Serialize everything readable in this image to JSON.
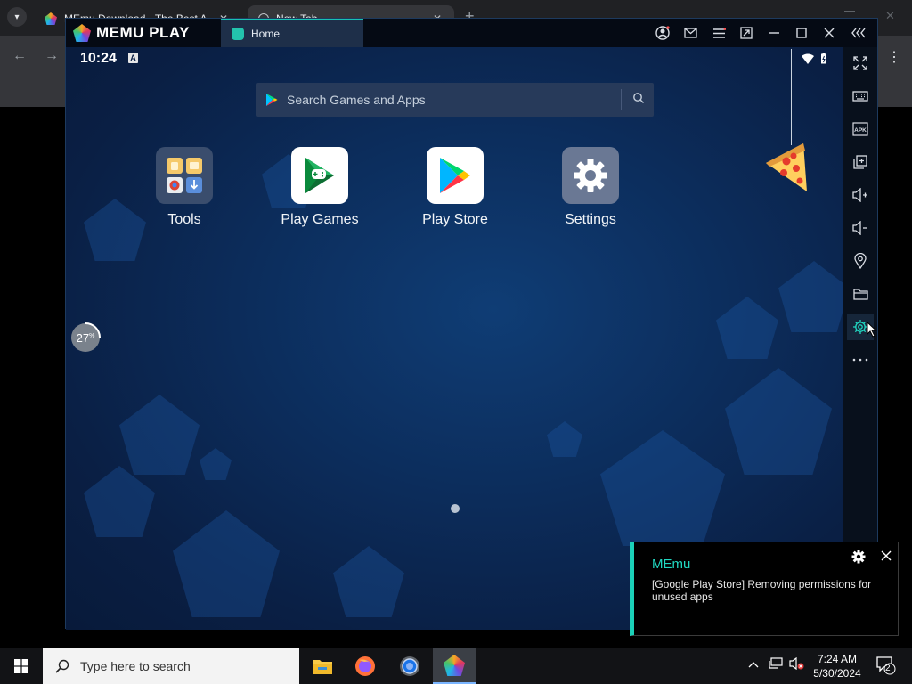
{
  "browser": {
    "tab1_title": "MEmu Download - The Best A",
    "tab2_title": "New Tab",
    "close_glyph": "✕",
    "new_tab_glyph": "+"
  },
  "memu": {
    "brand": "MEMU PLAY",
    "tab_label": "Home",
    "status_time": "10:24",
    "status_a": "A",
    "search_placeholder": "Search Games and Apps",
    "cpu_percent": "27",
    "cpu_unit": "%",
    "cpu_value": 27,
    "apps": [
      {
        "label": "Tools",
        "icon": "tools-folder-icon"
      },
      {
        "label": "Play Games",
        "icon": "play-games-icon"
      },
      {
        "label": "Play Store",
        "icon": "play-store-icon"
      },
      {
        "label": "Settings",
        "icon": "settings-icon"
      }
    ],
    "page_indicator": {
      "current": 1,
      "total": 1
    }
  },
  "notification": {
    "title": "MEmu",
    "body": "[Google Play Store] Removing permissions for unused apps"
  },
  "taskbar": {
    "search_placeholder": "Type here to search",
    "time": "7:24 AM",
    "date": "5/30/2024",
    "notification_count": "2"
  },
  "colors": {
    "accent": "#1bd1b9",
    "android_bg": "#0c2d5c",
    "taskbar": "#121316"
  }
}
